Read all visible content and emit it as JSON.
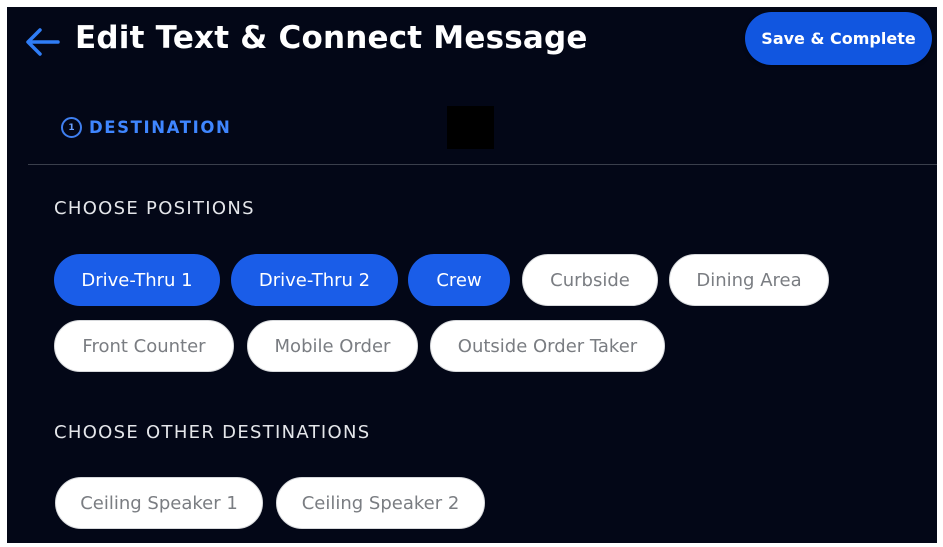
{
  "header": {
    "title": "Edit Text & Connect Message",
    "save_label": "Save & Complete",
    "back_icon": "arrow-left-icon"
  },
  "step": {
    "number": "1",
    "label": "DESTINATION"
  },
  "positions": {
    "heading": "CHOOSE POSITIONS",
    "chips": [
      {
        "label": "Drive-Thru 1",
        "selected": true
      },
      {
        "label": "Drive-Thru 2",
        "selected": true
      },
      {
        "label": "Crew",
        "selected": true
      },
      {
        "label": "Curbside",
        "selected": false
      },
      {
        "label": "Dining Area",
        "selected": false
      },
      {
        "label": "Front Counter",
        "selected": false
      },
      {
        "label": "Mobile Order",
        "selected": false
      },
      {
        "label": "Outside Order Taker",
        "selected": false
      }
    ]
  },
  "other": {
    "heading": "CHOOSE OTHER DESTINATIONS",
    "chips": [
      {
        "label": "Ceiling Speaker 1",
        "selected": false
      },
      {
        "label": "Ceiling Speaker 2",
        "selected": false
      }
    ]
  },
  "colors": {
    "background": "#030717",
    "accent": "#1a5de8",
    "step_accent": "#3f86ff",
    "chip_unselected_bg": "#ffffff",
    "chip_unselected_text": "#7a7d82"
  }
}
